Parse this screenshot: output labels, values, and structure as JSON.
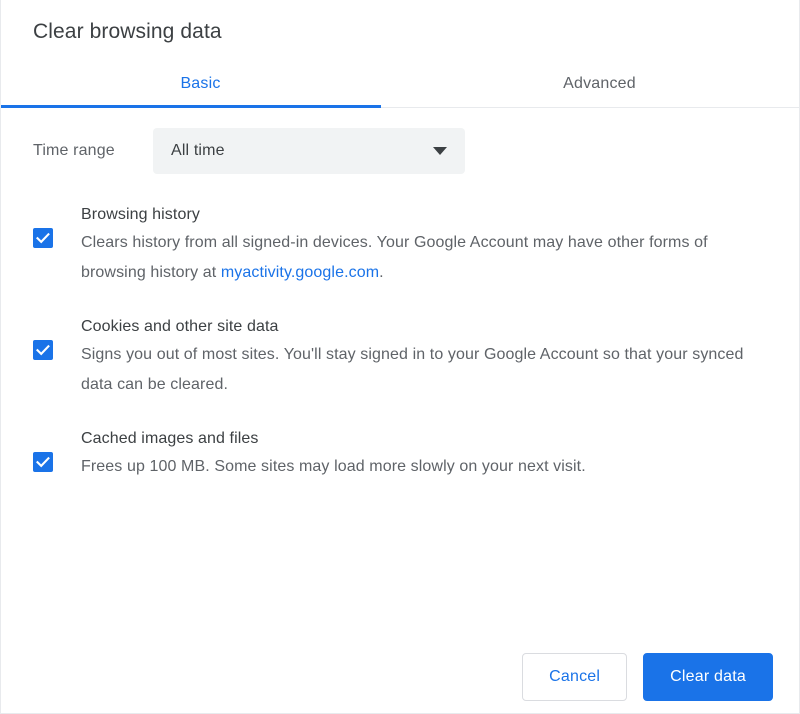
{
  "dialog": {
    "title": "Clear browsing data"
  },
  "tabs": [
    {
      "label": "Basic",
      "active": true
    },
    {
      "label": "Advanced",
      "active": false
    }
  ],
  "time_range": {
    "label": "Time range",
    "selected": "All time",
    "arrow_icon": "chevron-down-icon"
  },
  "options": [
    {
      "title": "Browsing history",
      "desc_before_link": "Clears history from all signed-in devices. Your Google Account may have other forms of browsing history at ",
      "link_text": "myactivity.google.com",
      "desc_after_link": ".",
      "checked": true,
      "checkbox_icon": "checkmark-icon"
    },
    {
      "title": "Cookies and other site data",
      "desc_before_link": "Signs you out of most sites. You'll stay signed in to your Google Account so that your synced data can be cleared.",
      "link_text": "",
      "desc_after_link": "",
      "checked": true,
      "checkbox_icon": "checkmark-icon"
    },
    {
      "title": "Cached images and files",
      "desc_before_link": "Frees up 100 MB. Some sites may load more slowly on your next visit.",
      "link_text": "",
      "desc_after_link": "",
      "checked": true,
      "checkbox_icon": "checkmark-icon"
    }
  ],
  "footer": {
    "cancel_label": "Cancel",
    "confirm_label": "Clear data"
  },
  "colors": {
    "accent": "#1a73e8",
    "text_primary": "#3c4043",
    "text_secondary": "#5f6368",
    "divider": "#e8eaed",
    "select_bg": "#f1f3f4",
    "border": "#dadce0"
  }
}
